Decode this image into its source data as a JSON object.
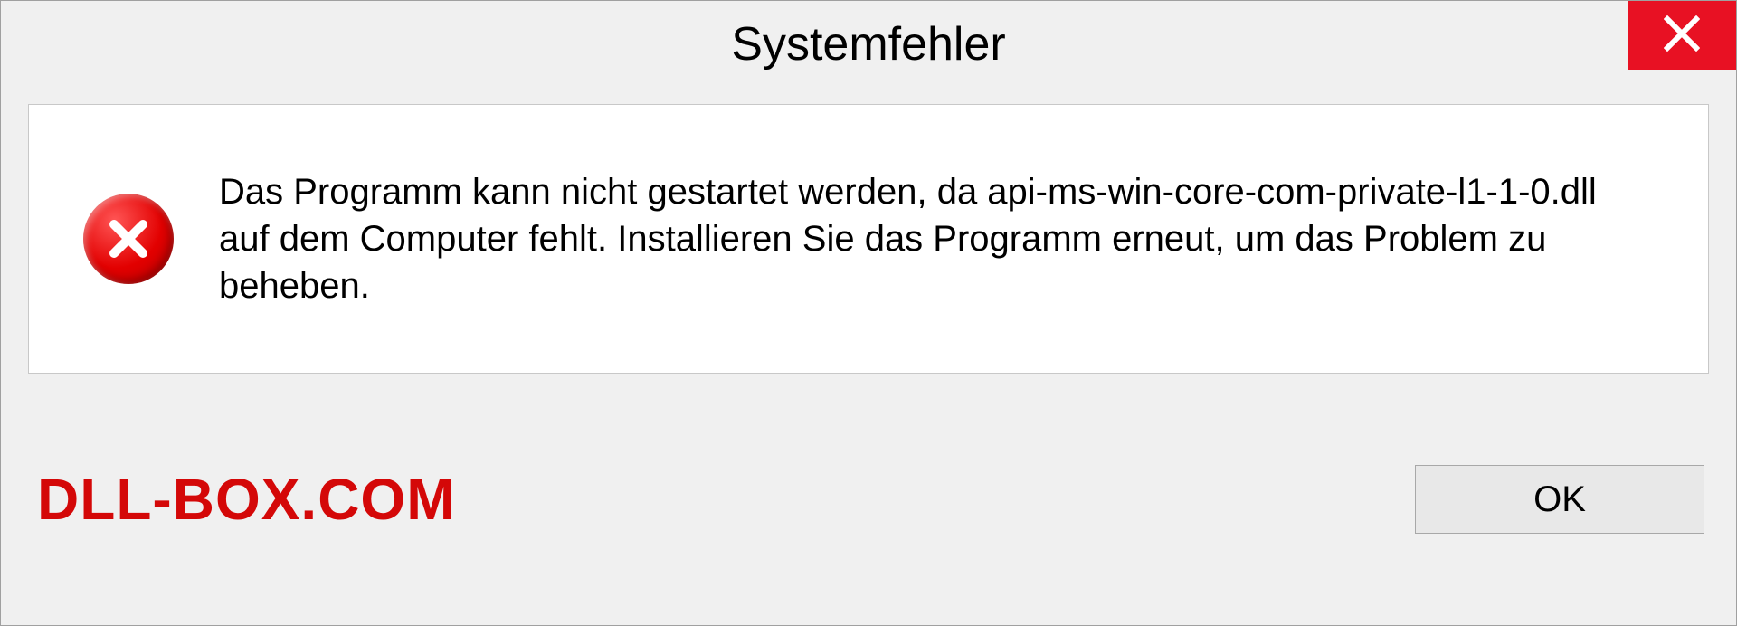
{
  "dialog": {
    "title": "Systemfehler",
    "message": "Das Programm kann nicht gestartet werden, da api-ms-win-core-com-private-l1-1-0.dll auf dem Computer fehlt. Installieren Sie das Programm erneut, um das Problem zu beheben.",
    "ok_label": "OK"
  },
  "watermark": "DLL-BOX.COM",
  "colors": {
    "close_bg": "#e81123",
    "error_red": "#d40808",
    "panel_bg": "#f0f0f0"
  }
}
